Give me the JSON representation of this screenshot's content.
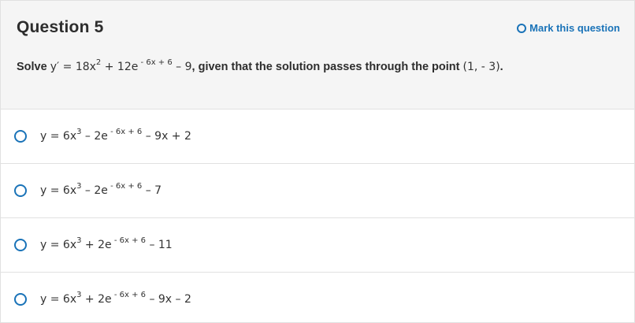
{
  "question": {
    "title": "Question 5",
    "mark_label": "Mark this question",
    "prompt_lead": "Solve ",
    "prompt_eq_base": "y′ = 18x",
    "prompt_eq_pow1": "2",
    "prompt_eq_mid": " + 12e",
    "prompt_eq_pow2": " - 6x + 6",
    "prompt_eq_tail": " – 9",
    "prompt_rest": ", given that the solution passes through the point ",
    "prompt_point": "(1, - 3)",
    "prompt_end": "."
  },
  "options": [
    {
      "a": "y = 6x",
      "p1": "3",
      "b": " – 2e",
      "p2": " - 6x + 6",
      "c": " – 9x + 2"
    },
    {
      "a": "y = 6x",
      "p1": "3",
      "b": " – 2e",
      "p2": " - 6x + 6",
      "c": " – 7"
    },
    {
      "a": "y = 6x",
      "p1": "3",
      "b": " + 2e",
      "p2": " - 6x + 6",
      "c": " – 11"
    },
    {
      "a": "y = 6x",
      "p1": "3",
      "b": " + 2e",
      "p2": " - 6x + 6",
      "c": " – 9x – 2"
    }
  ],
  "colors": {
    "accent": "#1a73b8",
    "header_bg": "#f5f5f5",
    "text": "#2d2d2d",
    "divider": "#e1e1e1"
  },
  "icons": {
    "mark": "circle-outline-icon",
    "option": "radio-button-icon"
  }
}
